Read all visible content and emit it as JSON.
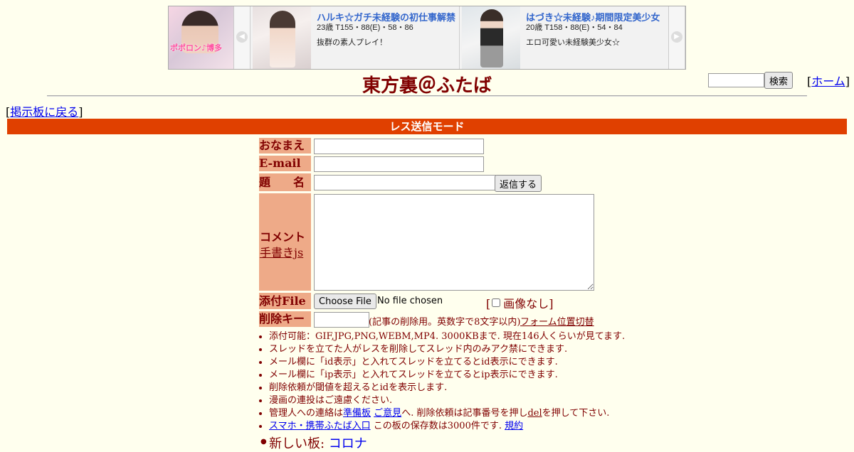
{
  "ad": {
    "logo_text": "ポポロン♪博多",
    "prev_icon": "◀",
    "next_icon": "▶",
    "items": [
      {
        "name": "ハルキ☆ガチ未経験の初仕事解禁",
        "spec": "23歳 T155・88(E)・58・86",
        "desc": "抜群の素人プレイ！"
      },
      {
        "name": "はづき☆未経験♪期間限定美少女",
        "spec": "20歳 T158・88(E)・54・84",
        "desc": "エロ可愛い未経験美少女☆"
      }
    ]
  },
  "header": {
    "title": "東方裏＠ふたば",
    "search_button": "検索",
    "home_link": "ホーム",
    "back_link": "掲示板に戻る"
  },
  "mode_bar": "レス送信モード",
  "form": {
    "name_label": "おなまえ",
    "email_label": "E-mail",
    "subject_label": "題　　名",
    "submit_button": "返信する",
    "comment_label": "コメント",
    "handwrite_link": "手書きjs",
    "file_label": "添付File",
    "choose_file_button": "Choose File",
    "no_file_text": "No file chosen",
    "no_image_label": "画像なし",
    "delkey_label": "削除キー",
    "delkey_note": "(記事の削除用。英数字で8文字以内)",
    "form_position_link": "フォーム位置切替"
  },
  "notes": [
    {
      "text": "添付可能：GIF,JPG,PNG,WEBM,MP4. 3000KBまで. 現在146人くらいが見てます."
    },
    {
      "text": "スレッドを立てた人がレスを削除してスレッド内のみアク禁にできます."
    },
    {
      "text": "メール欄に「id表示」と入れてスレッドを立てるとid表示にできます."
    },
    {
      "text": "メール欄に「ip表示」と入れてスレッドを立てるとip表示にできます."
    },
    {
      "text": "削除依頼が閾値を超えるとidを表示します."
    },
    {
      "text": "漫画の連投はご遠慮ください."
    }
  ],
  "note_contact": {
    "prefix": "管理人への連絡は",
    "link1": "準備板",
    "link2": "ご意見",
    "middle": "へ. 削除依頼は記事番号を押し",
    "link3": "del",
    "suffix": "を押して下さい."
  },
  "note_mobile": {
    "link": "スマホ・携帯ふたば入口",
    "text": " この板の保存数は3000件です. ",
    "rules_link": "規約"
  },
  "new_board": {
    "label": "新しい板: ",
    "link": "コロナ"
  }
}
